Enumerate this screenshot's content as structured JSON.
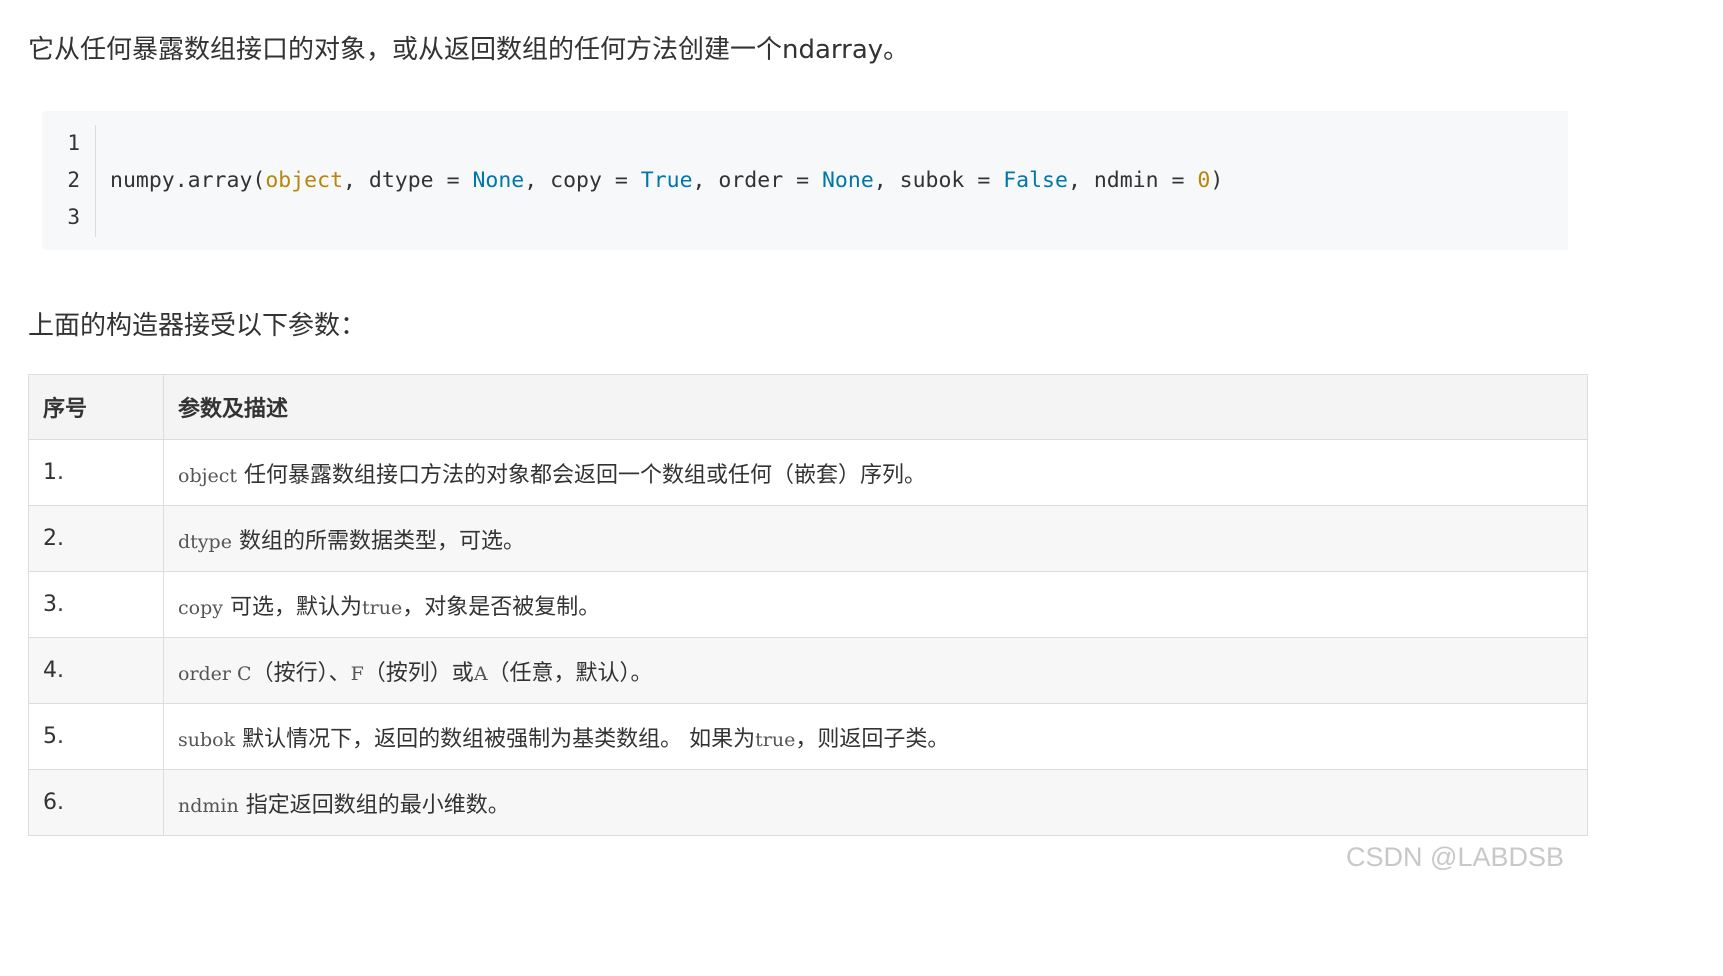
{
  "intro_text": "它从任何暴露数组接口的对象，或从返回数组的任何方法创建一个ndarray。",
  "code": {
    "line_numbers": [
      "1",
      "2",
      "3"
    ],
    "tokens": {
      "fn": "numpy.array(",
      "object": "object",
      "p1": ", dtype = ",
      "none1": "None",
      "p2": ", copy = ",
      "true1": "True",
      "p3": ", order = ",
      "none2": "None",
      "p4": ", subok = ",
      "false1": "False",
      "p5": ", ndmin = ",
      "zero": "0",
      "close": ")"
    }
  },
  "section_title": "上面的构造器接受以下参数：",
  "table": {
    "headers": [
      "序号",
      "参数及描述"
    ],
    "rows": [
      {
        "idx": "1.",
        "name": "object",
        "desc": " 任何暴露数组接口方法的对象都会返回一个数组或任何（嵌套）序列。"
      },
      {
        "idx": "2.",
        "name": "dtype",
        "desc": " 数组的所需数据类型，可选。"
      },
      {
        "idx": "3.",
        "name": "copy",
        "desc_a": " 可选，默认为",
        "inline": "true",
        "desc_b": "，对象是否被复制。"
      },
      {
        "idx": "4.",
        "name": "order",
        "c": " C",
        "desc_a": "（按行）、",
        "f": "F",
        "desc_b": "（按列）或",
        "a": "A",
        "desc_c": "（任意，默认）。"
      },
      {
        "idx": "5.",
        "name": "subok",
        "desc_a": " 默认情况下，返回的数组被强制为基类数组。 如果为",
        "inline": "true",
        "desc_b": "，则返回子类。"
      },
      {
        "idx": "6.",
        "name": "ndmin",
        "desc": " 指定返回数组的最小维数。"
      }
    ]
  },
  "watermark": "CSDN @LABDSB"
}
